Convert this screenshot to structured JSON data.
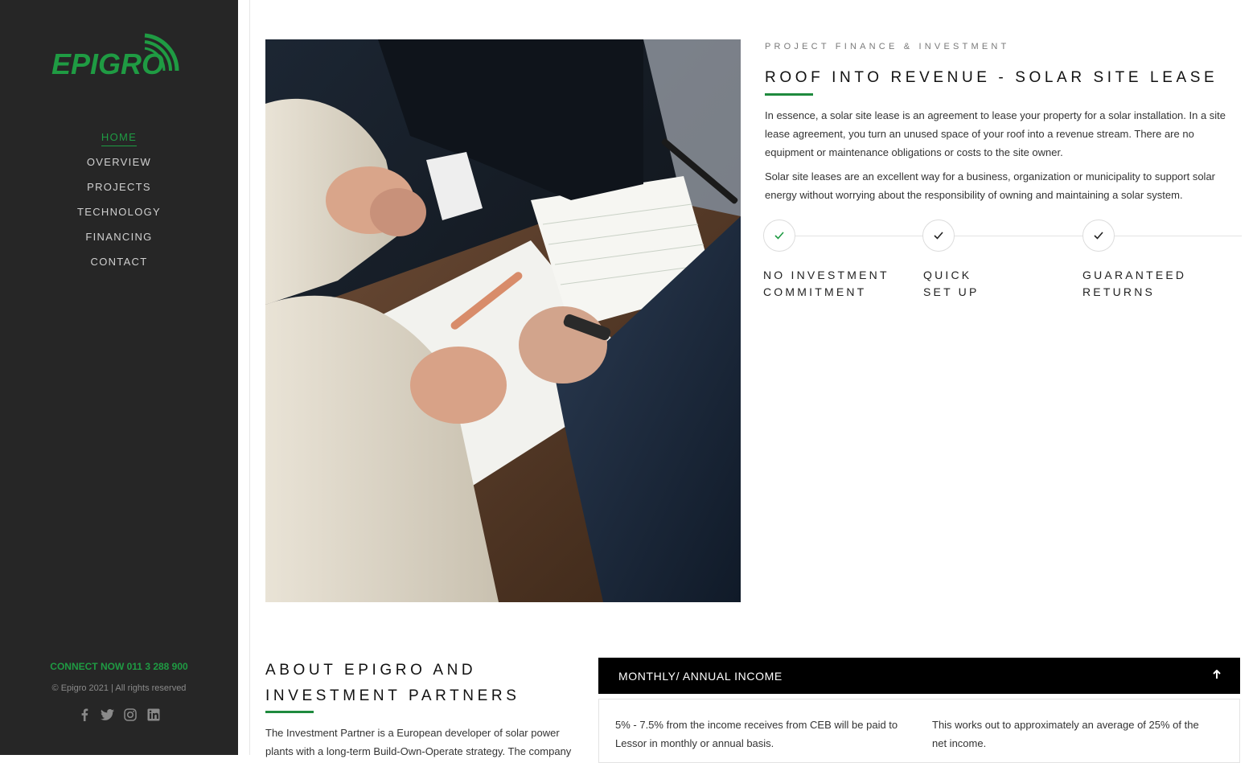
{
  "brand": {
    "name": "EPIGRO",
    "accent": "#1f9b43"
  },
  "nav": {
    "items": [
      {
        "label": "HOME",
        "active": true
      },
      {
        "label": "OVERVIEW",
        "active": false
      },
      {
        "label": "PROJECTS",
        "active": false
      },
      {
        "label": "TECHNOLOGY",
        "active": false
      },
      {
        "label": "FINANCING",
        "active": false
      },
      {
        "label": "CONTACT",
        "active": false
      }
    ]
  },
  "sidebar_footer": {
    "connect": "CONNECT NOW 011 3 288 900",
    "copyright": "© Epigro 2021 | All rights reserved",
    "socials": [
      "facebook-icon",
      "twitter-icon",
      "instagram-icon",
      "linkedin-icon"
    ]
  },
  "section": {
    "eyebrow": "PROJECT FINANCE & INVESTMENT",
    "headline": "ROOF INTO REVENUE - SOLAR SITE LEASE",
    "para1": "In essence, a solar site lease is an agreement to lease your property for a solar installation. In a site lease agreement, you turn an unused space of your roof into a revenue stream. There are no equipment or maintenance obligations or costs to the site owner.",
    "para2": "Solar site leases are an excellent way for a business, organization or municipality to support solar energy without worrying about the responsibility of owning and maintaining a solar system.",
    "steps": [
      {
        "line1": "NO INVESTMENT",
        "line2": "COMMITMENT",
        "checked_color": "#1f9b43"
      },
      {
        "line1": "QUICK",
        "line2": "SET UP",
        "checked_color": "#222222"
      },
      {
        "line1": "GUARANTEED",
        "line2": "RETURNS",
        "checked_color": "#222222"
      }
    ]
  },
  "about": {
    "title_line1": "ABOUT EPIGRO AND",
    "title_line2": "INVESTMENT PARTNERS",
    "text": "The Investment Partner is a European developer of solar power plants with a long-term Build-Own-Operate strategy. The company"
  },
  "accordion": {
    "title": "MONTHLY/ ANNUAL INCOME",
    "col1": "5% - 7.5% from the income receives from CEB will be paid to Lessor in monthly or annual basis.",
    "col2": "This works out to approximately an average of 25% of the net income."
  }
}
